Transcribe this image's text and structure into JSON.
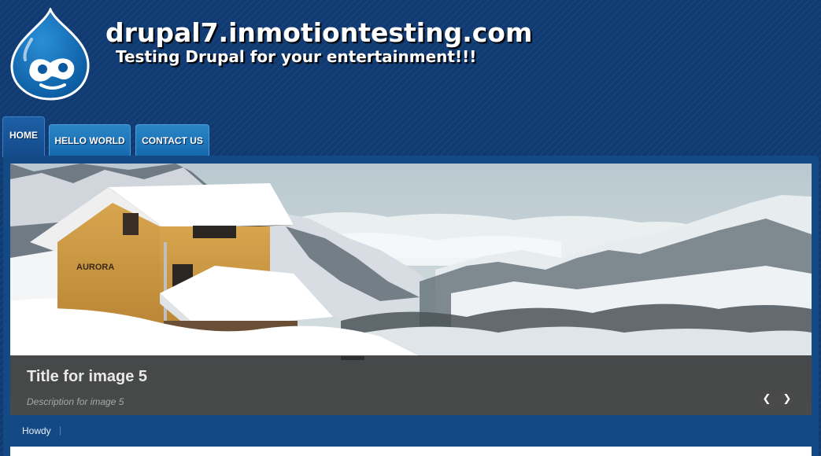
{
  "site": {
    "name": "drupal7.inmotiontesting.com",
    "slogan": "Testing Drupal for your entertainment!!!",
    "logo_icon": "drupal-drop-icon"
  },
  "nav": {
    "items": [
      {
        "label": "HOME",
        "active": true
      },
      {
        "label": "HELLO WORLD",
        "active": false
      },
      {
        "label": "CONTACT US",
        "active": false
      }
    ]
  },
  "slideshow": {
    "title": "Title for image 5",
    "description": "Description for image 5",
    "prev_icon": "chevron-left-icon",
    "next_icon": "chevron-right-icon",
    "prev_glyph": "❮",
    "next_glyph": "❯",
    "sign_text": "AURORA"
  },
  "footer": {
    "greeting": "Howdy",
    "separator": "|"
  },
  "colors": {
    "background": "#0f3a72",
    "tab_active": "#1a5498",
    "tab": "#1f78bb",
    "caption_bg": "#1e1e1e"
  }
}
